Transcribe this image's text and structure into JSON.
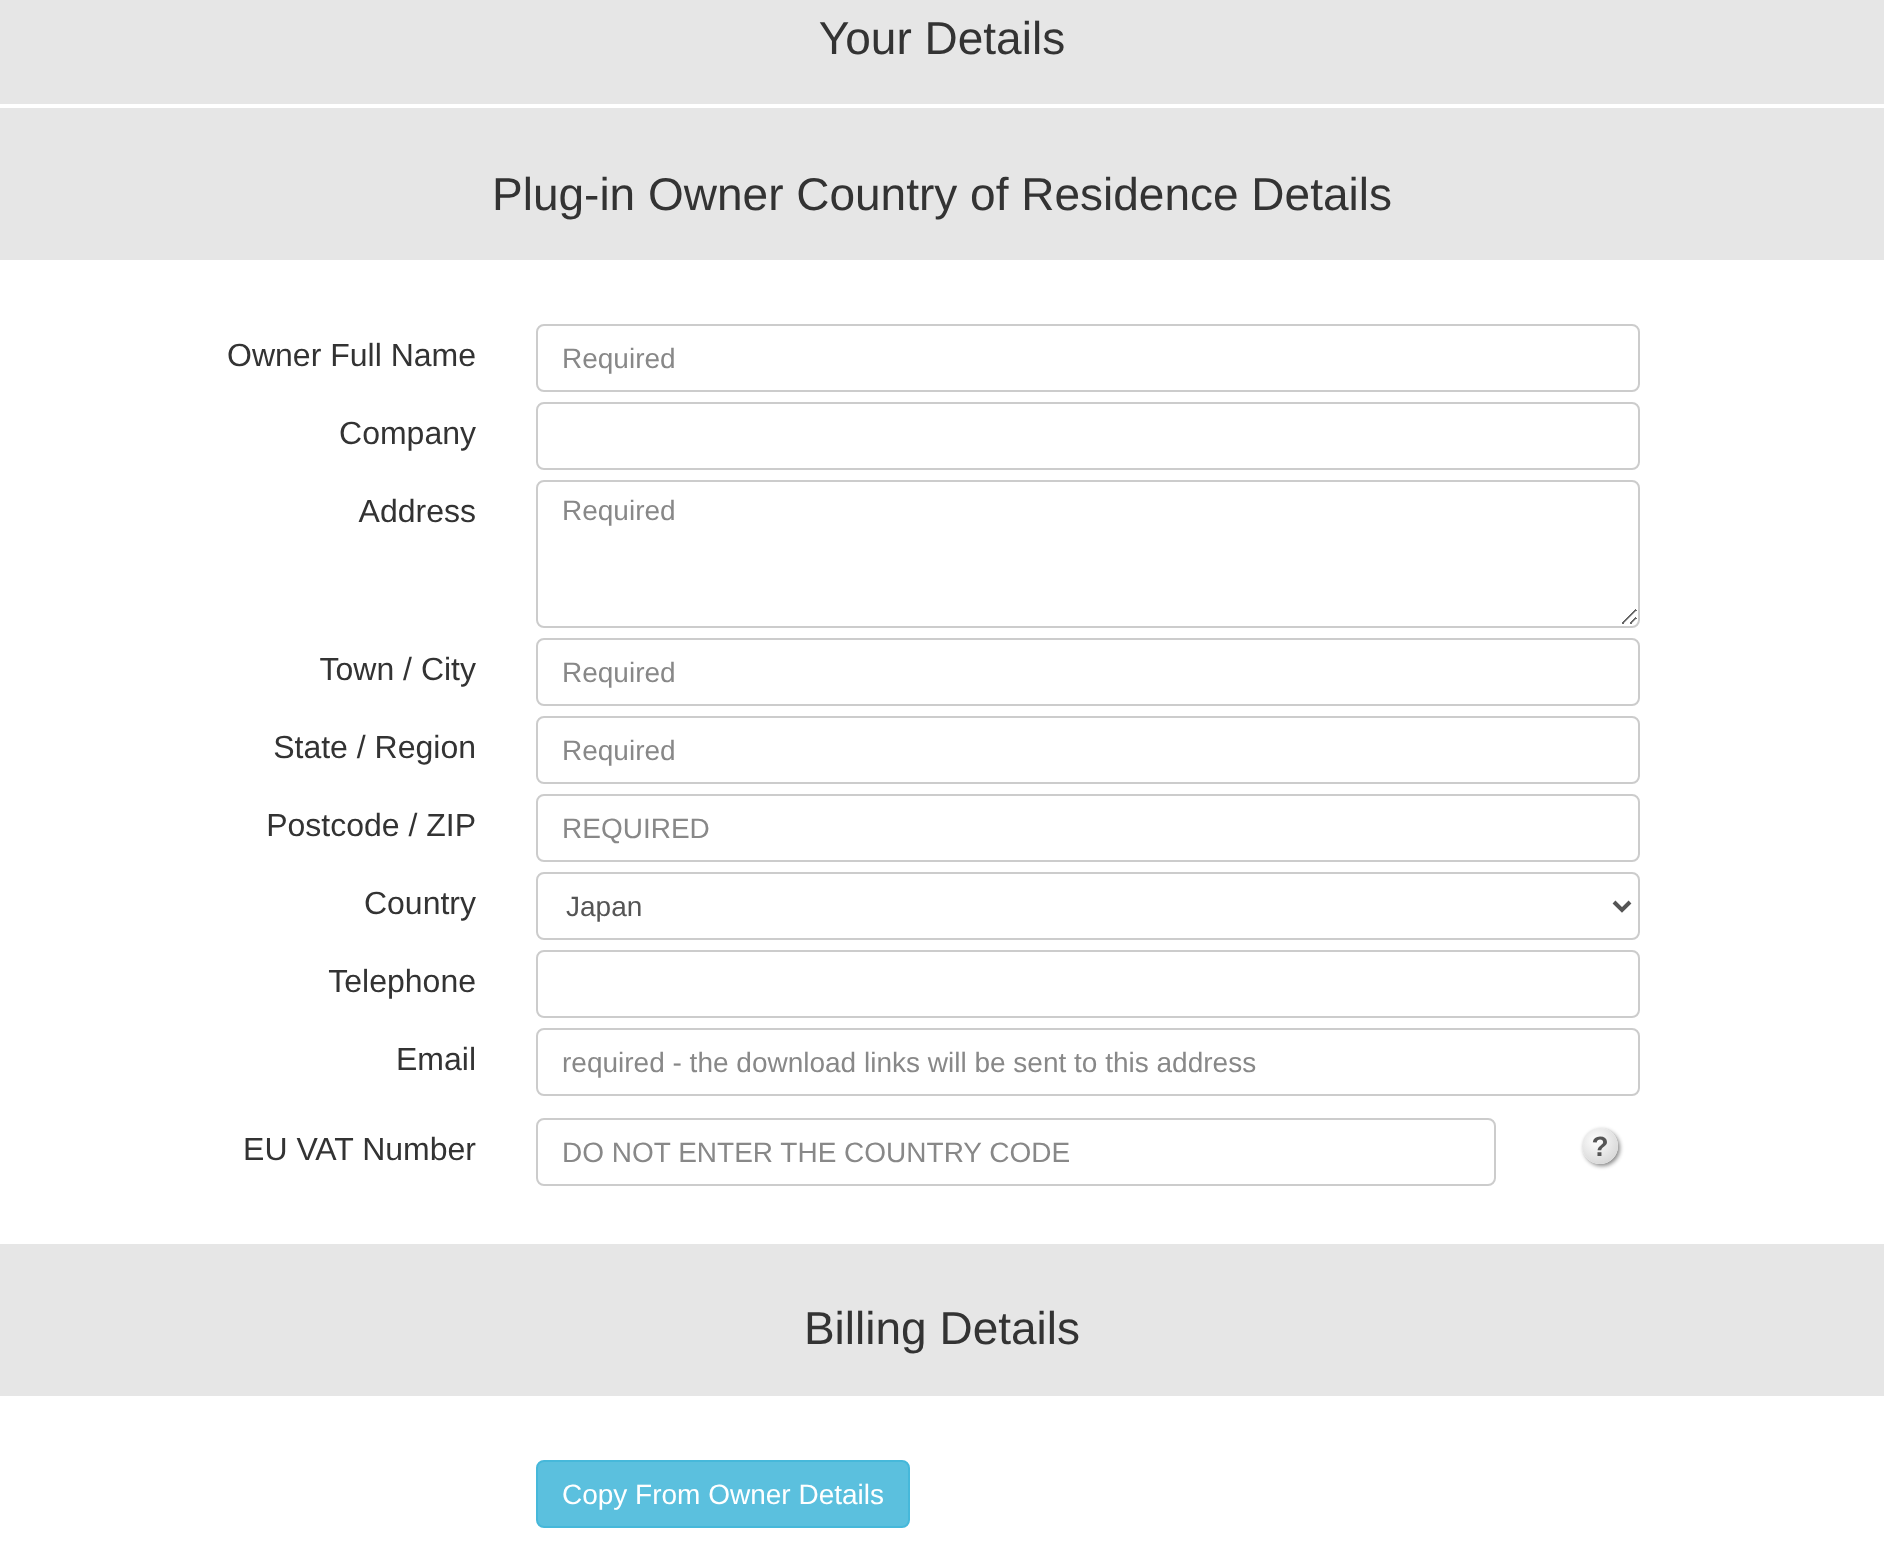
{
  "page_header": {
    "title": "Your Details"
  },
  "owner_section": {
    "title": "Plug-in Owner Country of Residence Details",
    "fields": [
      {
        "label": "Owner Full Name",
        "kind": "text",
        "placeholder": "Required"
      },
      {
        "label": "Company",
        "kind": "text"
      },
      {
        "label": "Address",
        "kind": "textarea",
        "placeholder": "Required"
      },
      {
        "label": "Town / City",
        "kind": "text",
        "placeholder": "Required"
      },
      {
        "label": "State / Region",
        "kind": "text",
        "placeholder": "Required"
      },
      {
        "label": "Postcode / ZIP",
        "kind": "text",
        "placeholder": "REQUIRED"
      },
      {
        "label": "Country",
        "kind": "select",
        "value": "Japan"
      },
      {
        "label": "Telephone",
        "kind": "text"
      },
      {
        "label": "Email",
        "kind": "text",
        "placeholder": "required - the download links will be sent to this address"
      },
      {
        "label": "EU VAT Number",
        "kind": "vat",
        "placeholder": "DO NOT ENTER THE COUNTRY CODE",
        "help": "?"
      }
    ]
  },
  "billing_section": {
    "title": "Billing Details",
    "button": "Copy From Owner Details"
  }
}
